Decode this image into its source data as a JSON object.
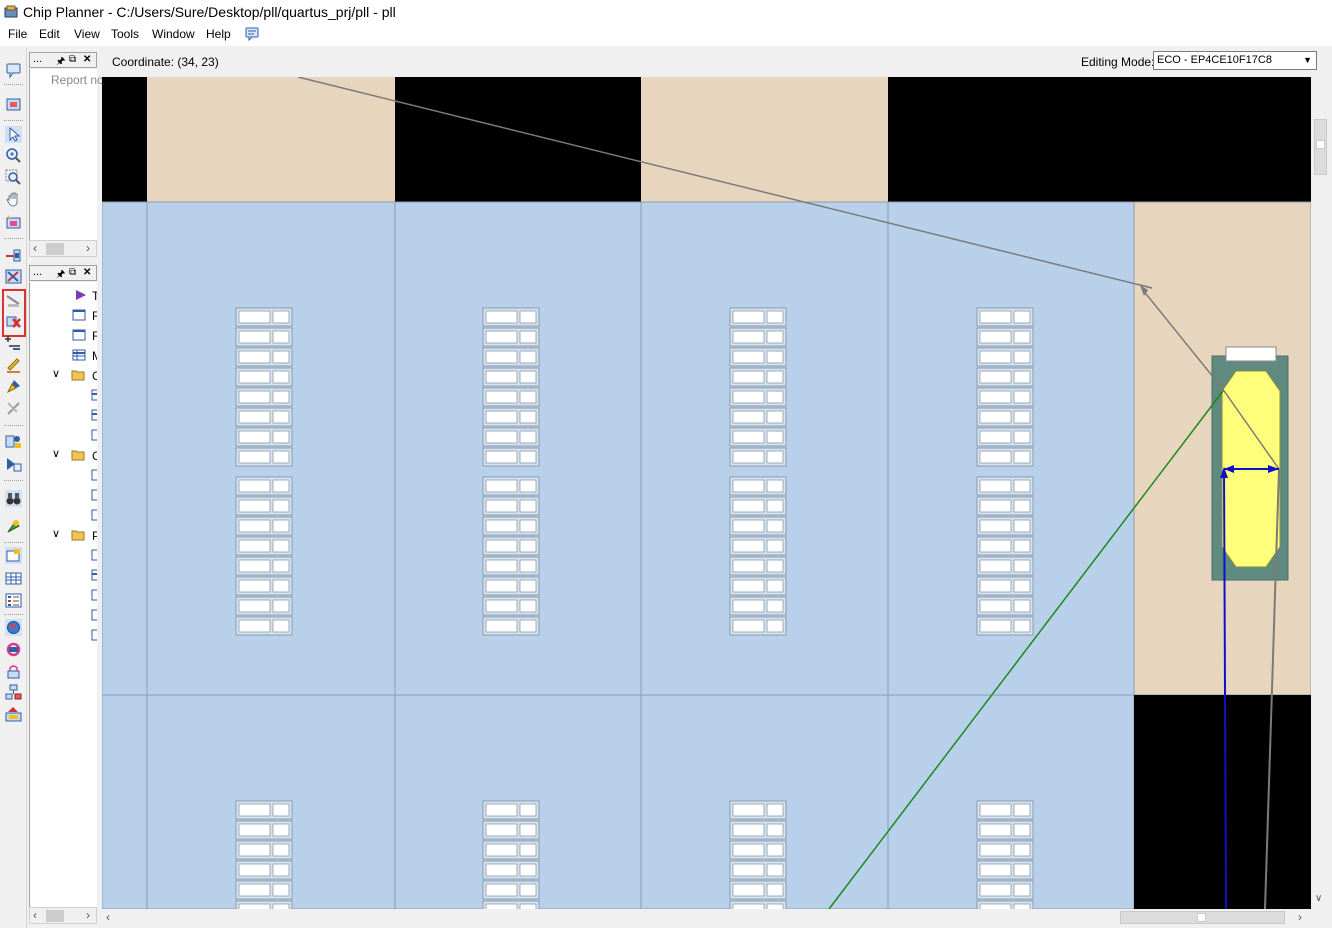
{
  "window": {
    "title": "Chip Planner - C:/Users/Sure/Desktop/pll/quartus_prj/pll - pll"
  },
  "menu": {
    "items": [
      "File",
      "Edit",
      "View",
      "Tools",
      "Window",
      "Help"
    ]
  },
  "panels": {
    "top": {
      "header_label": "...",
      "body_text": "Report no"
    },
    "bottom": {
      "header_label": "...",
      "tree": [
        {
          "icon": "play-icon",
          "label": "T"
        },
        {
          "icon": "report-icon",
          "label": "R"
        },
        {
          "icon": "report-icon",
          "label": "R"
        },
        {
          "icon": "table-icon",
          "label": "M"
        },
        {
          "icon": "folder-icon",
          "label": "C",
          "expanded": true
        },
        {
          "icon": "folder-icon",
          "label": "C",
          "expanded": true
        },
        {
          "icon": "folder-icon",
          "label": "P",
          "expanded": true
        }
      ]
    }
  },
  "coordinate": {
    "text": "Coordinate: (34, 23)"
  },
  "editing_mode": {
    "label": "Editing Mode:",
    "value": "ECO - EP4CE10F17C8"
  },
  "toolbar_icons": [
    "comment-icon",
    "layers-icon",
    "select-arrow-icon",
    "zoom-in-icon",
    "zoom-region-icon",
    "hand-pan-icon",
    "highlight-icon",
    "fan-in-icon",
    "fan-out-icon",
    "routing-delay-icon",
    "delete-connection-icon",
    "add-connection-icon",
    "pencil-icon",
    "brush-icon",
    "clear-icon",
    "assign-icon",
    "report-chart-icon",
    "binoculars-icon",
    "locate-icon",
    "layer-settings-icon",
    "grid-icon",
    "list-icon",
    "globe-icon",
    "refresh-icon",
    "lock-icon",
    "hierarchy-icon",
    "export-icon"
  ],
  "colors": {
    "lab_fill": "#b8d0ea",
    "io_fill": "#e8d5bd",
    "empty_fill": "#000000",
    "pll_block": "#5f8a80",
    "pll_core": "#fefe7a",
    "routing_gray": "#7a7a7a",
    "routing_green": "#1a8a1a",
    "routing_blue": "#1010c8",
    "highlight_red": "#e03030"
  }
}
